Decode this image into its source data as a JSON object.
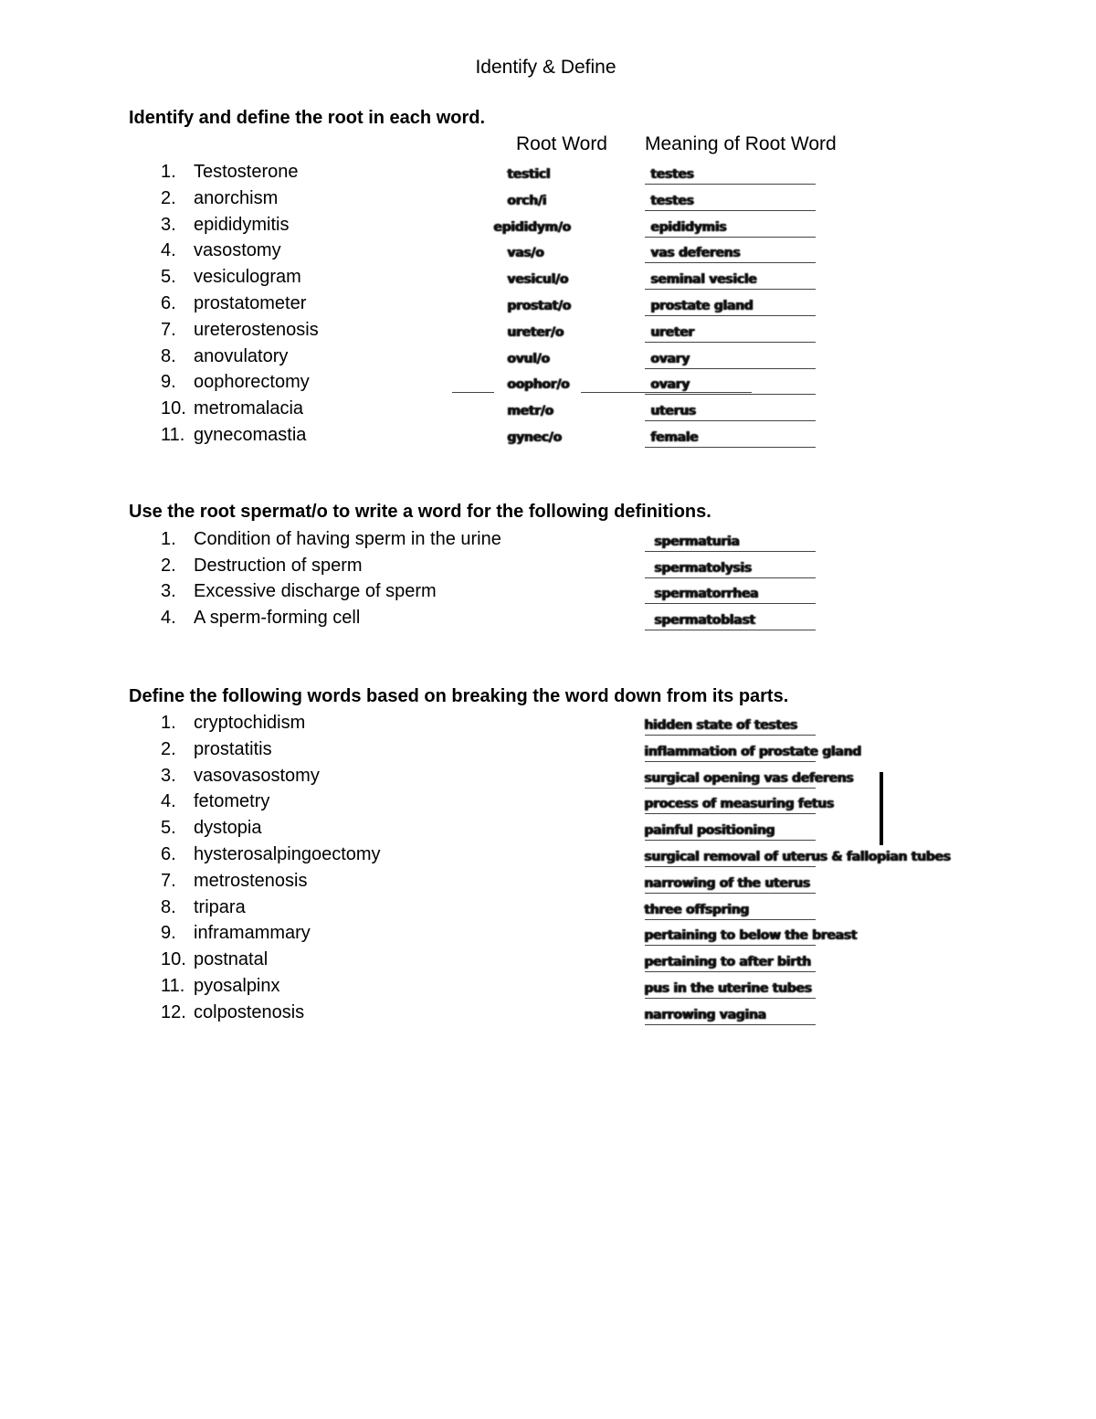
{
  "title": "Identify & Define",
  "section1": {
    "instruction": "Identify and define the root in each word.",
    "col_root": "Root Word",
    "col_meaning": "Meaning of Root Word",
    "items": [
      {
        "num": "1.",
        "word": "Testosterone",
        "root": "testicl",
        "meaning": "testes"
      },
      {
        "num": "2.",
        "word": "anorchism",
        "root": "orch/i",
        "meaning": "testes"
      },
      {
        "num": "3.",
        "word": "epididymitis",
        "root": "epididym/o",
        "meaning": "epididymis"
      },
      {
        "num": "4.",
        "word": "vasostomy",
        "root": "vas/o",
        "meaning": "vas deferens"
      },
      {
        "num": "5.",
        "word": "vesiculogram",
        "root": "vesicul/o",
        "meaning": "seminal vesicle"
      },
      {
        "num": "6.",
        "word": "prostatometer",
        "root": "prostat/o",
        "meaning": "prostate gland"
      },
      {
        "num": "7.",
        "word": "ureterostenosis",
        "root": "ureter/o",
        "meaning": "ureter"
      },
      {
        "num": "8.",
        "word": "anovulatory",
        "root": "ovul/o",
        "meaning": "ovary"
      },
      {
        "num": "9.",
        "word": "oophorectomy",
        "root": "oophor/o",
        "meaning": "ovary"
      },
      {
        "num": "10.",
        "word": "metromalacia",
        "root": "metr/o",
        "meaning": "uterus"
      },
      {
        "num": "11.",
        "word": "gynecomastia",
        "root": "gynec/o",
        "meaning": "female"
      }
    ]
  },
  "section2": {
    "instruction": "Use the root spermat/o to write a word for the following definitions.",
    "items": [
      {
        "num": "1.",
        "definition": "Condition of having sperm in the urine",
        "answer": "spermaturia"
      },
      {
        "num": "2.",
        "definition": "Destruction of sperm",
        "answer": "spermatolysis"
      },
      {
        "num": "3.",
        "definition": "Excessive discharge of sperm",
        "answer": "spermatorrhea"
      },
      {
        "num": "4.",
        "definition": "A sperm-forming cell",
        "answer": "spermatoblast"
      }
    ]
  },
  "section3": {
    "instruction": "Define the following words based on breaking the word down from its parts.",
    "items": [
      {
        "num": "1.",
        "word": "cryptochidism",
        "answer": "hidden state of testes"
      },
      {
        "num": "2.",
        "word": "prostatitis",
        "answer": "inflammation of prostate gland"
      },
      {
        "num": "3.",
        "word": "vasovasostomy",
        "answer": "surgical opening vas deferens"
      },
      {
        "num": "4.",
        "word": "fetometry",
        "answer": "process of measuring fetus"
      },
      {
        "num": "5.",
        "word": "dystopia",
        "answer": "painful positioning"
      },
      {
        "num": "6.",
        "word": "hysterosalpingoectomy",
        "answer": "surgical removal of uterus & fallopian tubes"
      },
      {
        "num": "7.",
        "word": "metrostenosis",
        "answer": "narrowing of the uterus"
      },
      {
        "num": "8.",
        "word": "tripara",
        "answer": "three offspring"
      },
      {
        "num": "9.",
        "word": "inframammary",
        "answer": "pertaining to below the breast"
      },
      {
        "num": "10.",
        "word": "postnatal",
        "answer": "pertaining to after birth"
      },
      {
        "num": "11.",
        "word": "pyosalpinx",
        "answer": "pus in the uterine tubes"
      },
      {
        "num": "12.",
        "word": "colpostenosis",
        "answer": "narrowing vagina"
      }
    ]
  }
}
